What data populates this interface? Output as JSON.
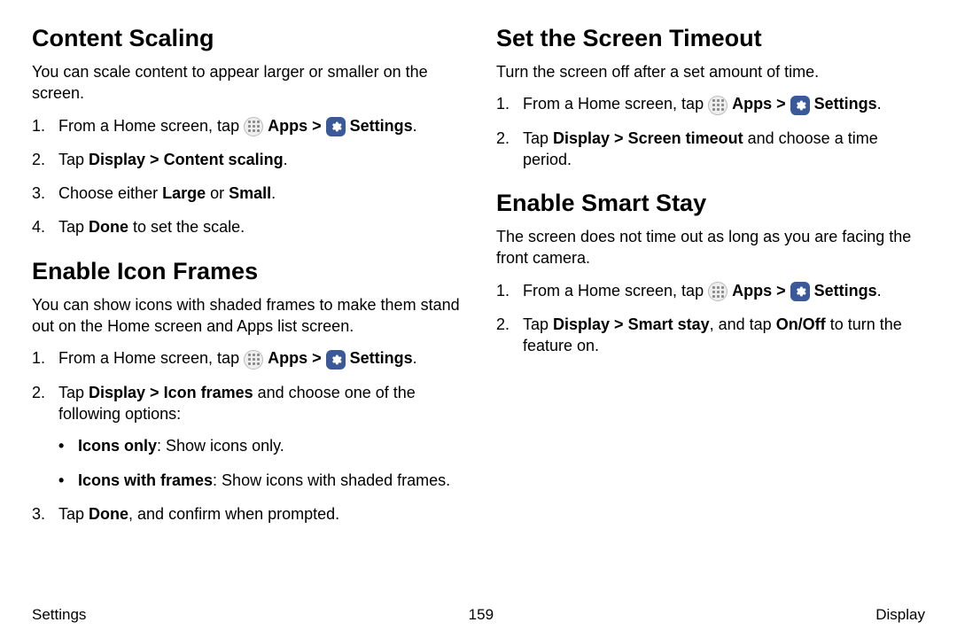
{
  "left": {
    "content_scaling": {
      "heading": "Content Scaling",
      "intro": "You can scale content to appear larger or smaller on the screen.",
      "steps": {
        "s1_pre": "From a Home screen, tap ",
        "apps": "Apps",
        "chev": " > ",
        "settings": "Settings",
        "period": ".",
        "s2_pre": "Tap ",
        "s2_bold": "Display > Content scaling",
        "s2_post": ".",
        "s3_pre": "Choose either ",
        "s3_bold1": "Large",
        "s3_mid": " or ",
        "s3_bold2": "Small",
        "s3_post": ".",
        "s4_pre": "Tap ",
        "s4_bold": "Done",
        "s4_post": " to set the scale."
      }
    },
    "icon_frames": {
      "heading": "Enable Icon Frames",
      "intro": "You can show icons with shaded frames to make them stand out on the Home screen and Apps list screen.",
      "steps": {
        "s1_pre": "From a Home screen, tap ",
        "apps": "Apps",
        "chev": " > ",
        "settings": "Settings",
        "period": ".",
        "s2_pre": "Tap ",
        "s2_bold": "Display > Icon frames",
        "s2_post": " and choose one of the following options:",
        "b1_bold": "Icons only",
        "b1_post": ": Show icons only.",
        "b2_bold": "Icons with frames",
        "b2_post": ": Show icons with shaded frames.",
        "s3_pre": "Tap ",
        "s3_bold": "Done",
        "s3_post": ", and confirm when prompted."
      }
    }
  },
  "right": {
    "screen_timeout": {
      "heading": "Set the Screen Timeout",
      "intro": "Turn the screen off after a set amount of time.",
      "steps": {
        "s1_pre": "From a Home screen, tap ",
        "apps": "Apps",
        "chev": " > ",
        "settings": "Settings",
        "period": ".",
        "s2_pre": "Tap ",
        "s2_bold": "Display > Screen timeout",
        "s2_post": " and choose a time period."
      }
    },
    "smart_stay": {
      "heading": "Enable Smart Stay",
      "intro": "The screen does not time out as long as you are facing the front camera.",
      "steps": {
        "s1_pre": "From a Home screen, tap ",
        "apps": "Apps",
        "chev": " > ",
        "settings": "Settings",
        "period": ".",
        "s2_pre": "Tap ",
        "s2_bold": "Display > Smart stay",
        "s2_mid": ", and tap ",
        "s2_bold2": "On/Off",
        "s2_post": " to turn the feature on."
      }
    }
  },
  "footer": {
    "left": "Settings",
    "center": "159",
    "right": "Display"
  }
}
